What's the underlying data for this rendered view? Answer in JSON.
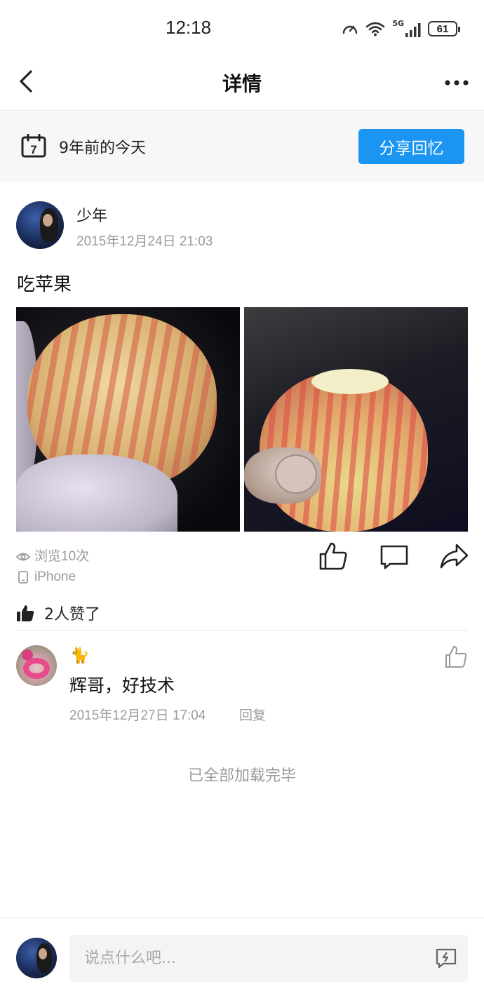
{
  "status_bar": {
    "time": "12:18",
    "network": "5G",
    "battery": "61"
  },
  "nav": {
    "title": "详情",
    "back_icon": "chevron-left-icon",
    "more_icon": "more-dots-icon"
  },
  "memory": {
    "day_number": "7",
    "text": "9年前的今天",
    "share_label": "分享回忆",
    "accent": "#1a95f2"
  },
  "post": {
    "author": "少年",
    "date": "2015年12月24日 21:03",
    "text": "吃苹果",
    "views": "浏览10次",
    "device": "iPhone",
    "likes": "2人赞了"
  },
  "comments": [
    {
      "name": "🐈",
      "text": "辉哥，好技术",
      "date": "2015年12月27日 17:04",
      "reply_label": "回复"
    }
  ],
  "list_end_text": "已全部加载完毕",
  "composer": {
    "placeholder": "说点什么吧..."
  }
}
